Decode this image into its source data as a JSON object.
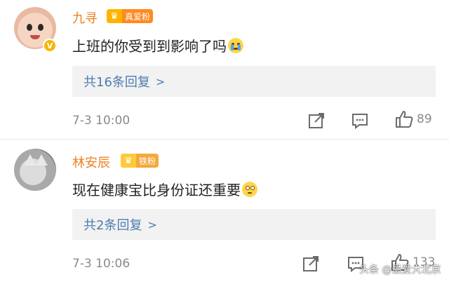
{
  "comments": [
    {
      "username": "九寻",
      "fan_badge": "真爱粉",
      "text": "上班的你受到到影响了吗",
      "emoji": "crying-emoji",
      "replies_label": "共16条回复",
      "timestamp": "7-3 10:00",
      "like_count": "89"
    },
    {
      "username": "林安辰",
      "fan_badge": "铁粉",
      "text": "现在健康宝比身份证还重要",
      "emoji": "rolling-eyes-emoji",
      "replies_label": "共2条回复",
      "timestamp": "7-3 10:06",
      "like_count": "133"
    }
  ],
  "watermark": "头条 @最爱大北京",
  "colors": {
    "username": "#f08121",
    "reply_link": "#4d7bb0",
    "reply_box_bg": "#f2f2f2",
    "timestamp": "#8a8a8a"
  }
}
